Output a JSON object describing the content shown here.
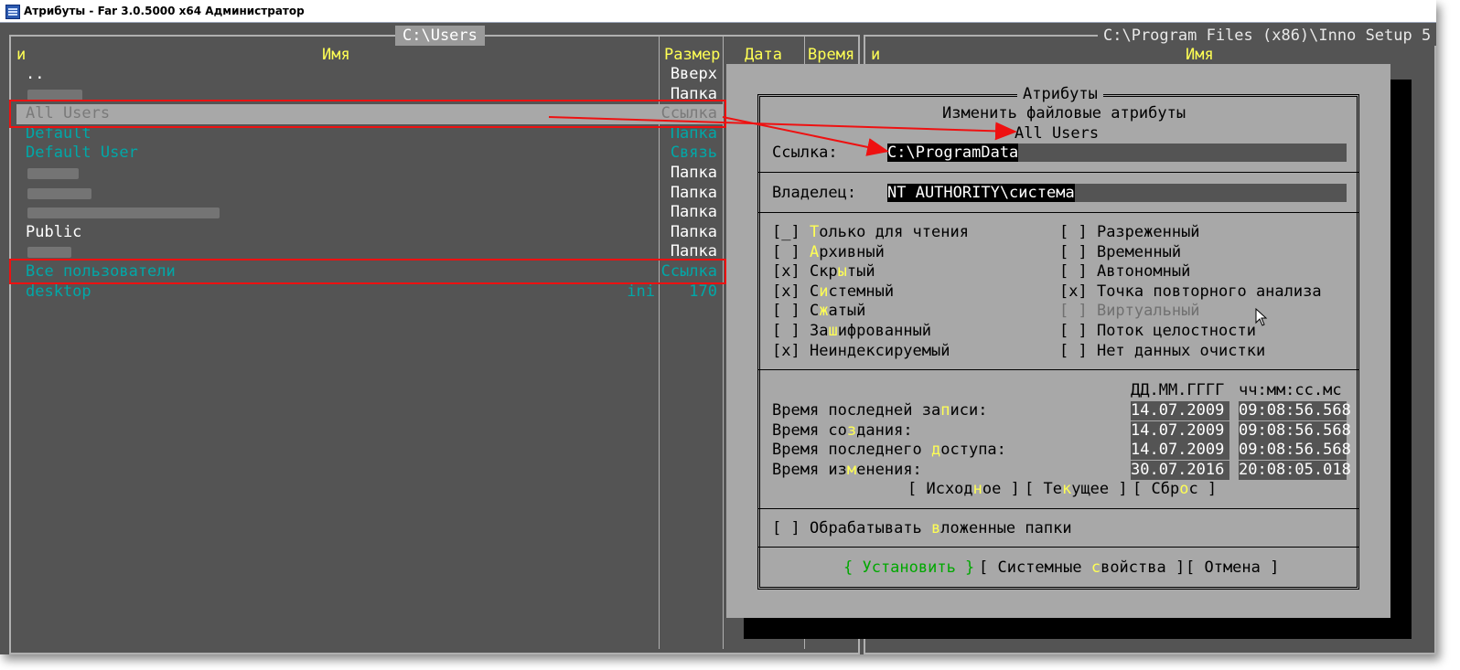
{
  "window": {
    "title": "Атрибуты - Far 3.0.5000 x64 Администратор"
  },
  "left_panel": {
    "path": "C:\\Users",
    "columns": {
      "sort": "и",
      "name": "Имя",
      "size": "Размер",
      "date": "Дата",
      "time": "Время"
    },
    "rows": [
      {
        "name": "..",
        "size": "Вверх",
        "color": "white"
      },
      {
        "name": "",
        "size": "Папка",
        "color": "white",
        "blurred": true
      },
      {
        "name": "All Users",
        "size": "Ссылка",
        "color": "gray",
        "selected": true
      },
      {
        "name": "Default",
        "size": "Папка",
        "color": "teal"
      },
      {
        "name": "Default User",
        "size": "Связь",
        "color": "teal"
      },
      {
        "name": "",
        "size": "Папка",
        "color": "white",
        "blurred": true
      },
      {
        "name": "",
        "size": "Папка",
        "color": "white",
        "blurred": true
      },
      {
        "name": "",
        "size": "Папка",
        "color": "white",
        "blurred": true
      },
      {
        "name": "Public",
        "size": "Папка",
        "color": "white"
      },
      {
        "name": "",
        "size": "Папка",
        "color": "white",
        "blurred": true
      },
      {
        "name": "Все пользователи",
        "size": "Ссылка",
        "color": "teal"
      },
      {
        "name": "desktop",
        "ext": "ini",
        "size": "170",
        "color": "teal"
      }
    ]
  },
  "right_panel": {
    "path": "C:\\Program Files (x86)\\Inno Setup 5",
    "columns": {
      "sort": "и",
      "name": "Имя"
    }
  },
  "dialog": {
    "title": "Атрибуты",
    "subtitle": "Изменить файловые атрибуты",
    "target": "All Users",
    "link_label": "Ссылка:",
    "link_value": "C:\\ProgramData",
    "owner_label": "Владелец:",
    "owner_value": "NT AUTHORITY\\система",
    "attributes_left": [
      {
        "mark": "[_]",
        "pre": "",
        "hot": "Т",
        "post": "олько для чтения"
      },
      {
        "mark": "[ ]",
        "pre": "",
        "hot": "А",
        "post": "рхивный"
      },
      {
        "mark": "[x]",
        "pre": "Скр",
        "hot": "ы",
        "post": "тый"
      },
      {
        "mark": "[x]",
        "pre": "С",
        "hot": "и",
        "post": "стемный"
      },
      {
        "mark": "[ ]",
        "pre": "С",
        "hot": "ж",
        "post": "атый"
      },
      {
        "mark": "[ ]",
        "pre": "За",
        "hot": "ш",
        "post": "ифрованный"
      },
      {
        "mark": "[x]",
        "pre": "",
        "hot": "",
        "post": "Неиндексируемый"
      }
    ],
    "attributes_right": [
      {
        "mark": "[ ]",
        "label": "Разреженный"
      },
      {
        "mark": "[ ]",
        "label": "Временный"
      },
      {
        "mark": "[ ]",
        "label": "Автономный"
      },
      {
        "mark": "[x]",
        "label": "Точка повторного анализа"
      },
      {
        "mark": "[ ]",
        "label": "Виртуальный",
        "disabled": true
      },
      {
        "mark": "[ ]",
        "label": "Поток целостности"
      },
      {
        "mark": "[ ]",
        "label": "Нет данных очистки"
      }
    ],
    "date_header": "ДД.ММ.ГГГГ",
    "time_header": "чч:мм:сс.мс",
    "times": [
      {
        "pre": "Время последней за",
        "hot": "п",
        "post": "иси:",
        "date": "14.07.2009",
        "time": "09:08:56.568"
      },
      {
        "pre": "Время со",
        "hot": "з",
        "post": "дания:",
        "date": "14.07.2009",
        "time": "09:08:56.568"
      },
      {
        "pre": "Время последнего ",
        "hot": "д",
        "post": "оступа:",
        "date": "14.07.2009",
        "time": "09:08:56.568"
      },
      {
        "pre": "Время из",
        "hot": "м",
        "post": "енения:",
        "date": "30.07.2016",
        "time": "20:08:05.018"
      }
    ],
    "time_buttons": [
      {
        "pre": "[ Исход",
        "hot": "н",
        "post": "ое ]"
      },
      {
        "pre": "[ Те",
        "hot": "к",
        "post": "ущее ]"
      },
      {
        "pre": "[ Сбр",
        "hot": "о",
        "post": "с ]"
      }
    ],
    "subfolders": {
      "mark": "[ ]",
      "pre": "Обрабатывать ",
      "hot": "в",
      "post": "ложенные папки"
    },
    "buttons": {
      "ok": "{ Установить }",
      "sys_pre": "[ Системные ",
      "sys_hot": "с",
      "sys_post": "войства ]",
      "cancel": "[ Отмена ]"
    }
  }
}
